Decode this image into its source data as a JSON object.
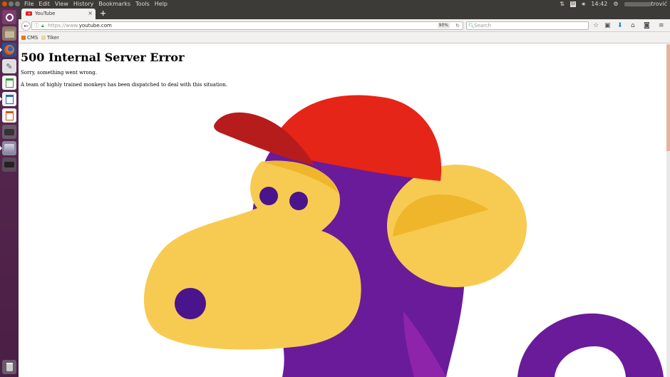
{
  "system": {
    "menu": [
      "File",
      "Edit",
      "View",
      "History",
      "Bookmarks",
      "Tools",
      "Help"
    ],
    "time": "14:42",
    "user_suffix": "trović"
  },
  "browser": {
    "tab_title": "YouTube",
    "url_prefix": "https://www.",
    "url_domain": "youtube.com",
    "zoom": "90%",
    "search_placeholder": "Search"
  },
  "bookmarks": [
    {
      "label": "CMS"
    },
    {
      "label": "Tiker"
    }
  ],
  "page": {
    "heading": "500 Internal Server Error",
    "line1": "Sorry, something went wrong.",
    "line2": "A team of highly trained monkeys has been dispatched to deal with this situation."
  },
  "colors": {
    "monkey_face": "#f7cb52",
    "monkey_shade": "#efb62c",
    "monkey_fur": "#6a1b9a",
    "monkey_eye": "#4a148c",
    "cap_red": "#e52518",
    "cap_dark": "#b71c1c",
    "launcher": "#4a1f45"
  },
  "icons": {
    "back": "arrow-left-icon",
    "reload": "reload-icon",
    "bookmark": "star-icon",
    "downloads": "download-arrow-icon",
    "home": "home-icon",
    "pocket": "pocket-icon",
    "menu": "hamburger-menu-icon"
  }
}
